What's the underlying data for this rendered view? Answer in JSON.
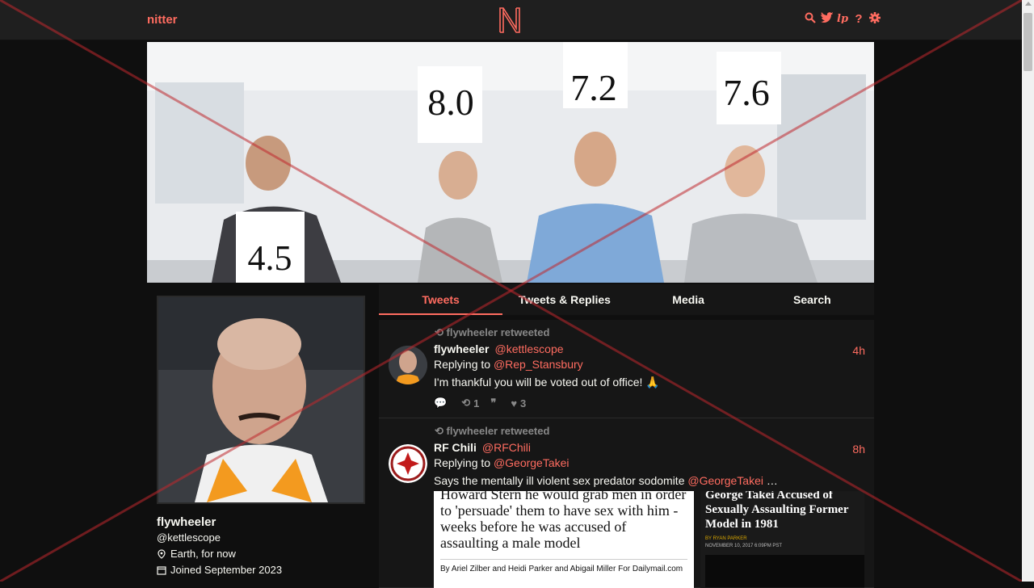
{
  "navbar": {
    "brand": "nitter",
    "logo_letter": "N",
    "icons": [
      "search-icon",
      "twitter-bird-icon",
      "rss-icon",
      "help-icon",
      "gear-icon"
    ]
  },
  "banner": {
    "scores": [
      "4.5",
      "8.0",
      "7.2",
      "7.6"
    ]
  },
  "profile": {
    "name": "flywheeler",
    "handle": "@kettlescope",
    "location": "Earth, for now",
    "joined": "Joined September 2023"
  },
  "tabs": [
    {
      "label": "Tweets",
      "active": true
    },
    {
      "label": "Tweets & Replies",
      "active": false
    },
    {
      "label": "Media",
      "active": false
    },
    {
      "label": "Search",
      "active": false
    }
  ],
  "tweets": [
    {
      "retweet_label": "flywheeler retweeted",
      "name": "flywheeler",
      "username": "@kettlescope",
      "time": "4h",
      "replying_prefix": "Replying to",
      "replying_to": "@Rep_Stansbury",
      "text": "I'm thankful you will be voted out of office! 🙏",
      "replies": "",
      "retweets": "1",
      "quotes": "",
      "likes": "3"
    },
    {
      "retweet_label": "flywheeler retweeted",
      "name": "RF Chili",
      "username": "@RFChili",
      "time": "8h",
      "replying_prefix": "Replying to",
      "replying_to": "@GeorgeTakei",
      "text_prefix": "Says the mentally ill violent sex predator sodomite",
      "text_mention": "@GeorgeTakei",
      "text_suffix": " …",
      "media_left": {
        "headline": "Howard Stern he would grab men in order to 'persuade' them to have sex with him - weeks before he was accused of assaulting a male model",
        "byline": "By Ariel Zilber and Heidi Parker and Abigail Miller For Dailymail.com"
      },
      "media_right": {
        "headline": "George Takei Accused of Sexually Assaulting Former Model in 1981",
        "byline": "BY RYAN PARKER",
        "date": "NOVEMBER 10, 2017 6:09PM PST"
      }
    }
  ],
  "colors": {
    "accent": "#ff6c60",
    "background": "#0f0f0f",
    "panel": "#161616",
    "navbar": "#1f1f1f"
  }
}
